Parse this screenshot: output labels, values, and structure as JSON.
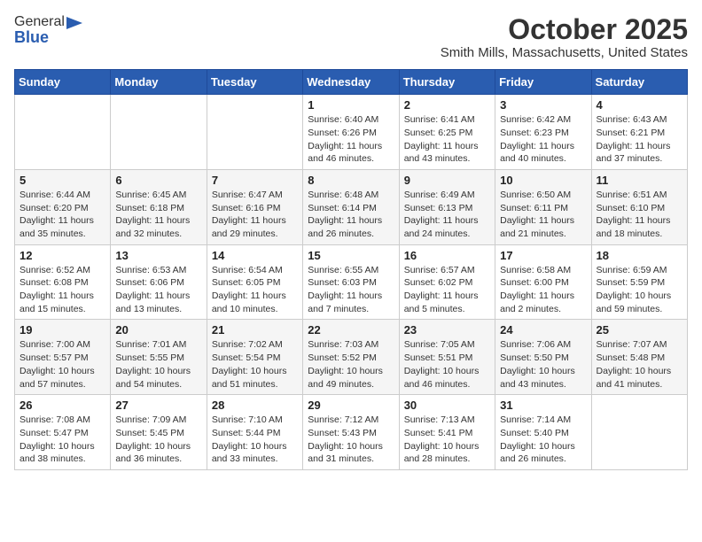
{
  "header": {
    "logo_general": "General",
    "logo_blue": "Blue",
    "title": "October 2025",
    "subtitle": "Smith Mills, Massachusetts, United States"
  },
  "calendar": {
    "headers": [
      "Sunday",
      "Monday",
      "Tuesday",
      "Wednesday",
      "Thursday",
      "Friday",
      "Saturday"
    ],
    "weeks": [
      [
        {
          "day": "",
          "info": ""
        },
        {
          "day": "",
          "info": ""
        },
        {
          "day": "",
          "info": ""
        },
        {
          "day": "1",
          "info": "Sunrise: 6:40 AM\nSunset: 6:26 PM\nDaylight: 11 hours\nand 46 minutes."
        },
        {
          "day": "2",
          "info": "Sunrise: 6:41 AM\nSunset: 6:25 PM\nDaylight: 11 hours\nand 43 minutes."
        },
        {
          "day": "3",
          "info": "Sunrise: 6:42 AM\nSunset: 6:23 PM\nDaylight: 11 hours\nand 40 minutes."
        },
        {
          "day": "4",
          "info": "Sunrise: 6:43 AM\nSunset: 6:21 PM\nDaylight: 11 hours\nand 37 minutes."
        }
      ],
      [
        {
          "day": "5",
          "info": "Sunrise: 6:44 AM\nSunset: 6:20 PM\nDaylight: 11 hours\nand 35 minutes."
        },
        {
          "day": "6",
          "info": "Sunrise: 6:45 AM\nSunset: 6:18 PM\nDaylight: 11 hours\nand 32 minutes."
        },
        {
          "day": "7",
          "info": "Sunrise: 6:47 AM\nSunset: 6:16 PM\nDaylight: 11 hours\nand 29 minutes."
        },
        {
          "day": "8",
          "info": "Sunrise: 6:48 AM\nSunset: 6:14 PM\nDaylight: 11 hours\nand 26 minutes."
        },
        {
          "day": "9",
          "info": "Sunrise: 6:49 AM\nSunset: 6:13 PM\nDaylight: 11 hours\nand 24 minutes."
        },
        {
          "day": "10",
          "info": "Sunrise: 6:50 AM\nSunset: 6:11 PM\nDaylight: 11 hours\nand 21 minutes."
        },
        {
          "day": "11",
          "info": "Sunrise: 6:51 AM\nSunset: 6:10 PM\nDaylight: 11 hours\nand 18 minutes."
        }
      ],
      [
        {
          "day": "12",
          "info": "Sunrise: 6:52 AM\nSunset: 6:08 PM\nDaylight: 11 hours\nand 15 minutes."
        },
        {
          "day": "13",
          "info": "Sunrise: 6:53 AM\nSunset: 6:06 PM\nDaylight: 11 hours\nand 13 minutes."
        },
        {
          "day": "14",
          "info": "Sunrise: 6:54 AM\nSunset: 6:05 PM\nDaylight: 11 hours\nand 10 minutes."
        },
        {
          "day": "15",
          "info": "Sunrise: 6:55 AM\nSunset: 6:03 PM\nDaylight: 11 hours\nand 7 minutes."
        },
        {
          "day": "16",
          "info": "Sunrise: 6:57 AM\nSunset: 6:02 PM\nDaylight: 11 hours\nand 5 minutes."
        },
        {
          "day": "17",
          "info": "Sunrise: 6:58 AM\nSunset: 6:00 PM\nDaylight: 11 hours\nand 2 minutes."
        },
        {
          "day": "18",
          "info": "Sunrise: 6:59 AM\nSunset: 5:59 PM\nDaylight: 10 hours\nand 59 minutes."
        }
      ],
      [
        {
          "day": "19",
          "info": "Sunrise: 7:00 AM\nSunset: 5:57 PM\nDaylight: 10 hours\nand 57 minutes."
        },
        {
          "day": "20",
          "info": "Sunrise: 7:01 AM\nSunset: 5:55 PM\nDaylight: 10 hours\nand 54 minutes."
        },
        {
          "day": "21",
          "info": "Sunrise: 7:02 AM\nSunset: 5:54 PM\nDaylight: 10 hours\nand 51 minutes."
        },
        {
          "day": "22",
          "info": "Sunrise: 7:03 AM\nSunset: 5:52 PM\nDaylight: 10 hours\nand 49 minutes."
        },
        {
          "day": "23",
          "info": "Sunrise: 7:05 AM\nSunset: 5:51 PM\nDaylight: 10 hours\nand 46 minutes."
        },
        {
          "day": "24",
          "info": "Sunrise: 7:06 AM\nSunset: 5:50 PM\nDaylight: 10 hours\nand 43 minutes."
        },
        {
          "day": "25",
          "info": "Sunrise: 7:07 AM\nSunset: 5:48 PM\nDaylight: 10 hours\nand 41 minutes."
        }
      ],
      [
        {
          "day": "26",
          "info": "Sunrise: 7:08 AM\nSunset: 5:47 PM\nDaylight: 10 hours\nand 38 minutes."
        },
        {
          "day": "27",
          "info": "Sunrise: 7:09 AM\nSunset: 5:45 PM\nDaylight: 10 hours\nand 36 minutes."
        },
        {
          "day": "28",
          "info": "Sunrise: 7:10 AM\nSunset: 5:44 PM\nDaylight: 10 hours\nand 33 minutes."
        },
        {
          "day": "29",
          "info": "Sunrise: 7:12 AM\nSunset: 5:43 PM\nDaylight: 10 hours\nand 31 minutes."
        },
        {
          "day": "30",
          "info": "Sunrise: 7:13 AM\nSunset: 5:41 PM\nDaylight: 10 hours\nand 28 minutes."
        },
        {
          "day": "31",
          "info": "Sunrise: 7:14 AM\nSunset: 5:40 PM\nDaylight: 10 hours\nand 26 minutes."
        },
        {
          "day": "",
          "info": ""
        }
      ]
    ]
  }
}
